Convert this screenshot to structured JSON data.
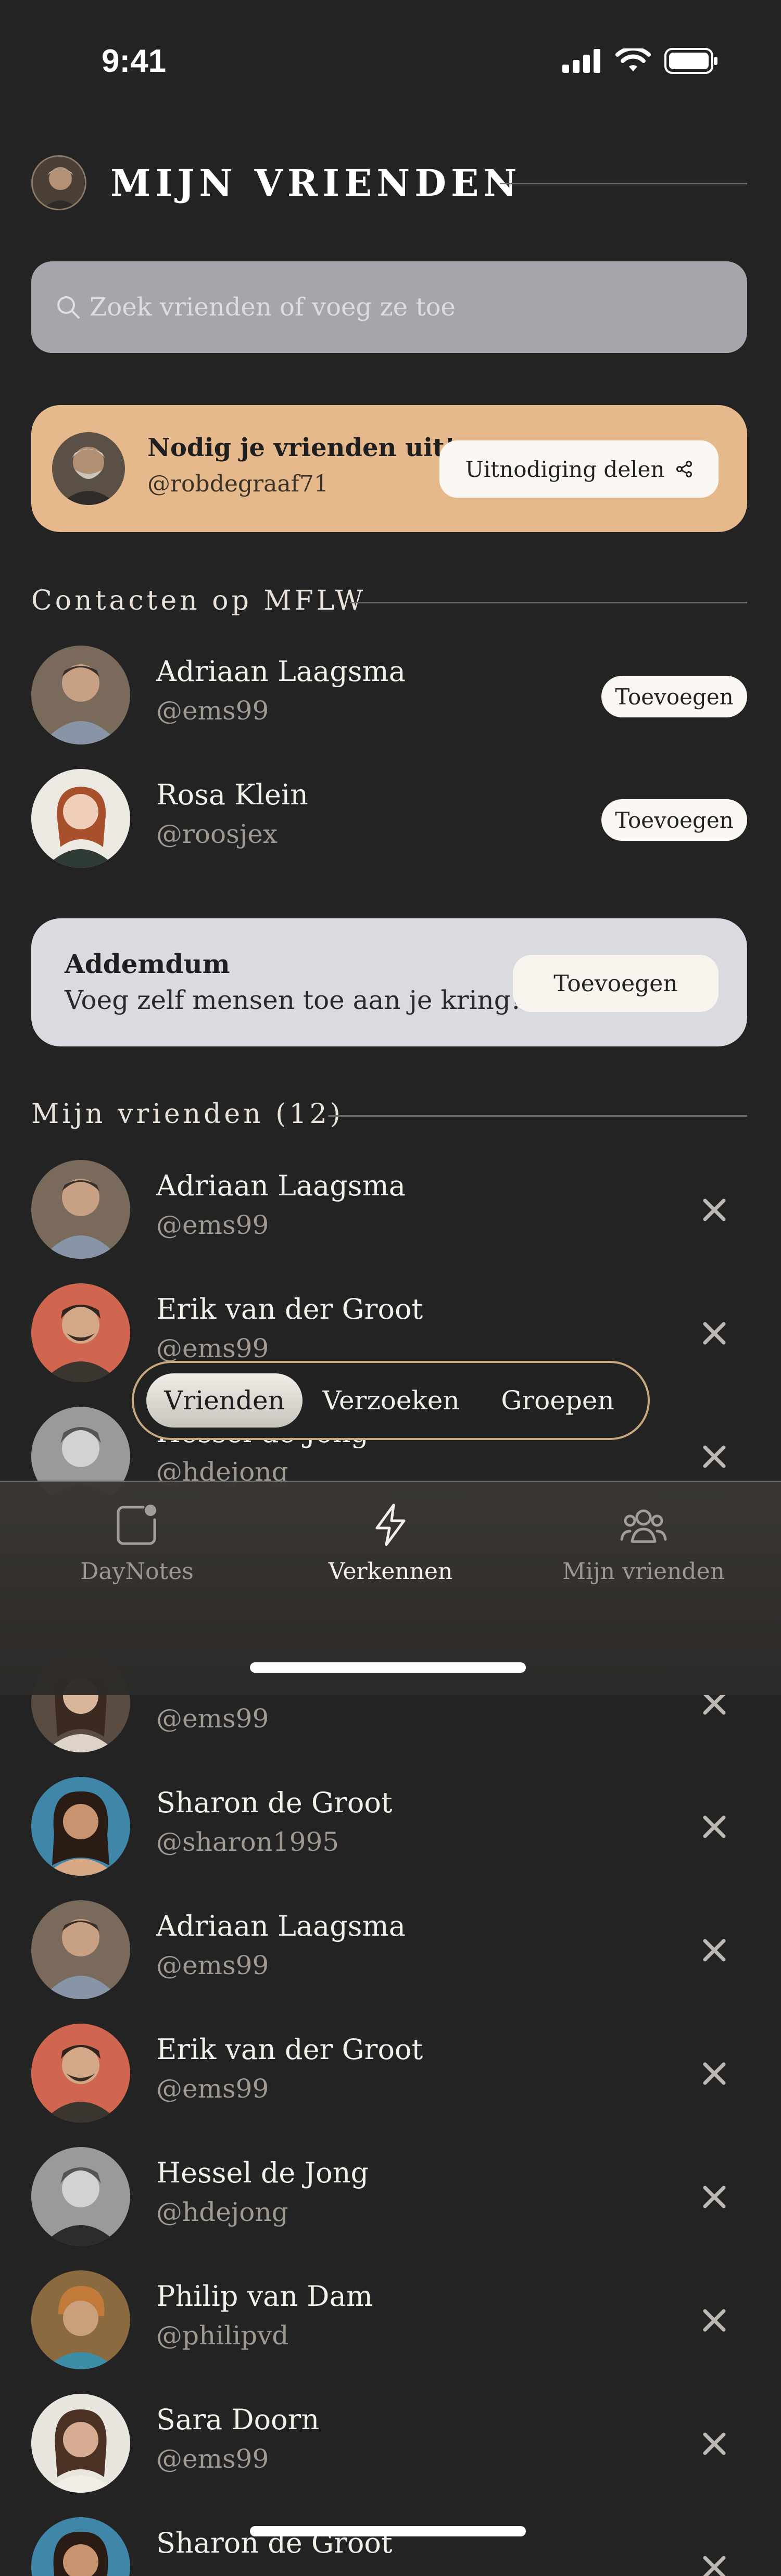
{
  "status_bar": {
    "time": "9:41"
  },
  "header": {
    "title": "MIJN VRIENDEN"
  },
  "search": {
    "placeholder": "Zoek vrienden of voeg ze toe"
  },
  "invite": {
    "title": "Nodig je vrienden uit!",
    "handle": "@robdegraaf71",
    "share_label": "Uitnodiging delen"
  },
  "contacts": {
    "title": "Contacten op MFLW",
    "add_label": "Toevoegen",
    "items": [
      {
        "name": "Adriaan Laagsma",
        "handle": "@ems99"
      },
      {
        "name": "Rosa Klein",
        "handle": "@roosjex"
      }
    ]
  },
  "addemdum": {
    "title": "Addemdum",
    "subtitle": "Voeg zelf mensen toe aan je kring!",
    "button_label": "Toevoegen"
  },
  "friends": {
    "title": "Mijn vrienden (12)",
    "items": [
      {
        "name": "Adriaan Laagsma",
        "handle": "@ems99"
      },
      {
        "name": "Erik van der Groot",
        "handle": "@ems99"
      },
      {
        "name": "Hessel de Jong",
        "handle": "@hdejong"
      },
      {
        "name": "",
        "handle": "@ems99"
      },
      {
        "name": "Sharon de Groot",
        "handle": "@sharon1995"
      },
      {
        "name": "Adriaan Laagsma",
        "handle": "@ems99"
      },
      {
        "name": "Erik van der Groot",
        "handle": "@ems99"
      },
      {
        "name": "Hessel de Jong",
        "handle": "@hdejong"
      },
      {
        "name": "Philip van Dam",
        "handle": "@philipvd"
      },
      {
        "name": "Sara Doorn",
        "handle": "@ems99"
      },
      {
        "name": "Sharon de Groot",
        "handle": ""
      }
    ]
  },
  "segmented_tabs": [
    {
      "label": "Vrienden",
      "active": true
    },
    {
      "label": "Verzoeken",
      "active": false
    },
    {
      "label": "Groepen",
      "active": false
    }
  ],
  "bottom_nav": [
    {
      "label": "DayNotes",
      "icon": "note-icon",
      "active": false
    },
    {
      "label": "Verkennen",
      "icon": "lightning-icon",
      "active": true
    },
    {
      "label": "Mijn vrienden",
      "icon": "friends-icon",
      "active": false
    }
  ],
  "colors": {
    "background": "#232323",
    "invite_card": "#e5b98b",
    "addemdum_card": "#d9dbe1",
    "search_bar": "#a5a6ab",
    "segment_border": "#c8a87f"
  }
}
